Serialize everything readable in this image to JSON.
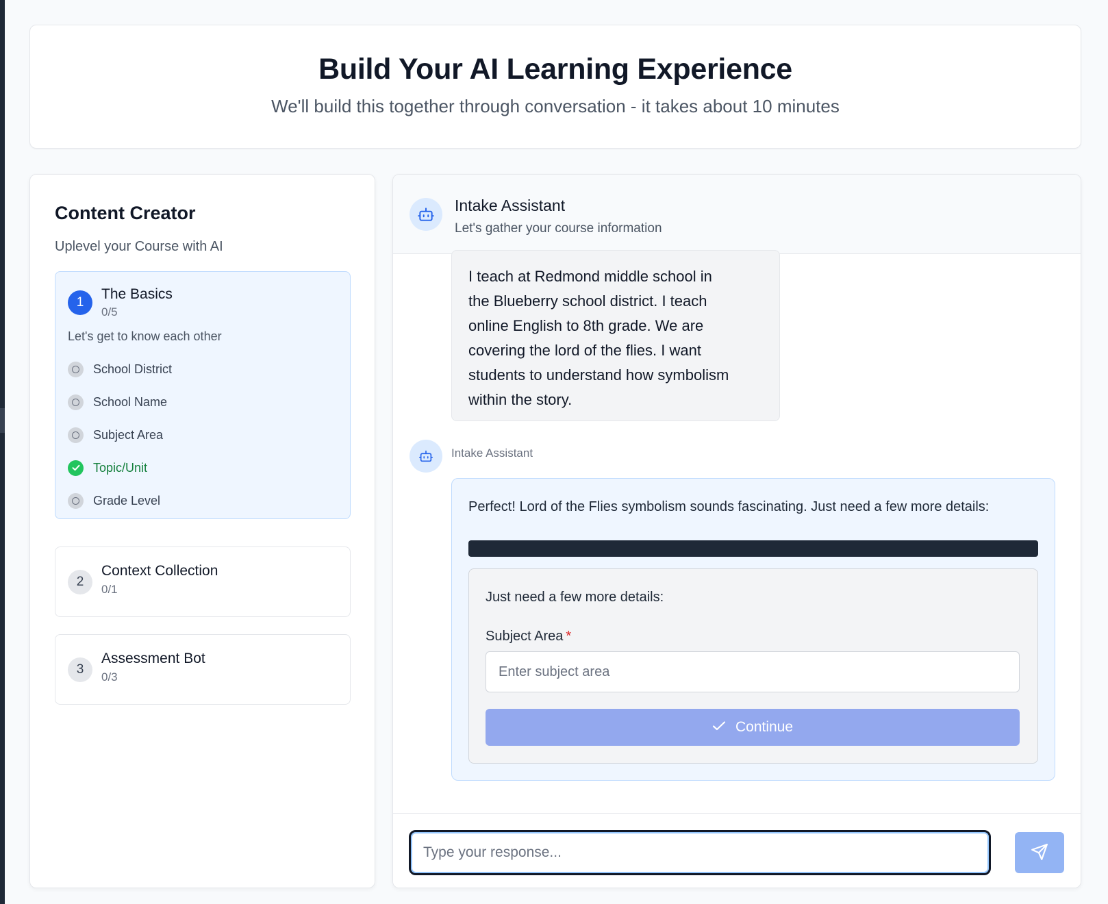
{
  "header": {
    "title": "Build Your AI Learning Experience",
    "subtitle": "We'll build this together through conversation - it takes about 10 minutes"
  },
  "sidebar": {
    "title": "Content Creator",
    "subtitle": "Uplevel your Course with AI",
    "steps": [
      {
        "number": "1",
        "name": "The Basics",
        "count": "0/5",
        "description": "Let's get to know each other",
        "items": [
          {
            "label": "School District",
            "done": false
          },
          {
            "label": "School Name",
            "done": false
          },
          {
            "label": "Subject Area",
            "done": false
          },
          {
            "label": "Topic/Unit",
            "done": true
          },
          {
            "label": "Grade Level",
            "done": false
          }
        ]
      },
      {
        "number": "2",
        "name": "Context Collection",
        "count": "0/1"
      },
      {
        "number": "3",
        "name": "Assessment Bot",
        "count": "0/3"
      }
    ]
  },
  "chat": {
    "assistant_name": "Intake Assistant",
    "assistant_tagline": "Let's gather your course information",
    "user_message_lines": [
      "I teach at Redmond middle school in",
      "the Blueberry school district. I teach",
      "online English to 8th grade. We are",
      "covering the lord of the flies. I want",
      "students to understand how symbolism",
      "within the story."
    ],
    "bot_sender": "Intake Assistant",
    "bot_message": "Perfect! Lord of the Flies symbolism sounds fascinating. Just need a few more details:",
    "form": {
      "heading": "Just need a few more details:",
      "field_label": "Subject Area",
      "required_mark": "*",
      "field_placeholder": "Enter subject area",
      "continue_label": "Continue"
    },
    "response_placeholder": "Type your response..."
  },
  "colors": {
    "accent": "#2563eb",
    "done_green": "#22c55e",
    "continue_button": "#93a8ee"
  },
  "icons": {
    "assistant": "robot-icon",
    "done": "check-circle-icon",
    "pending": "circle-icon",
    "continue": "check-icon",
    "send": "send-icon"
  }
}
